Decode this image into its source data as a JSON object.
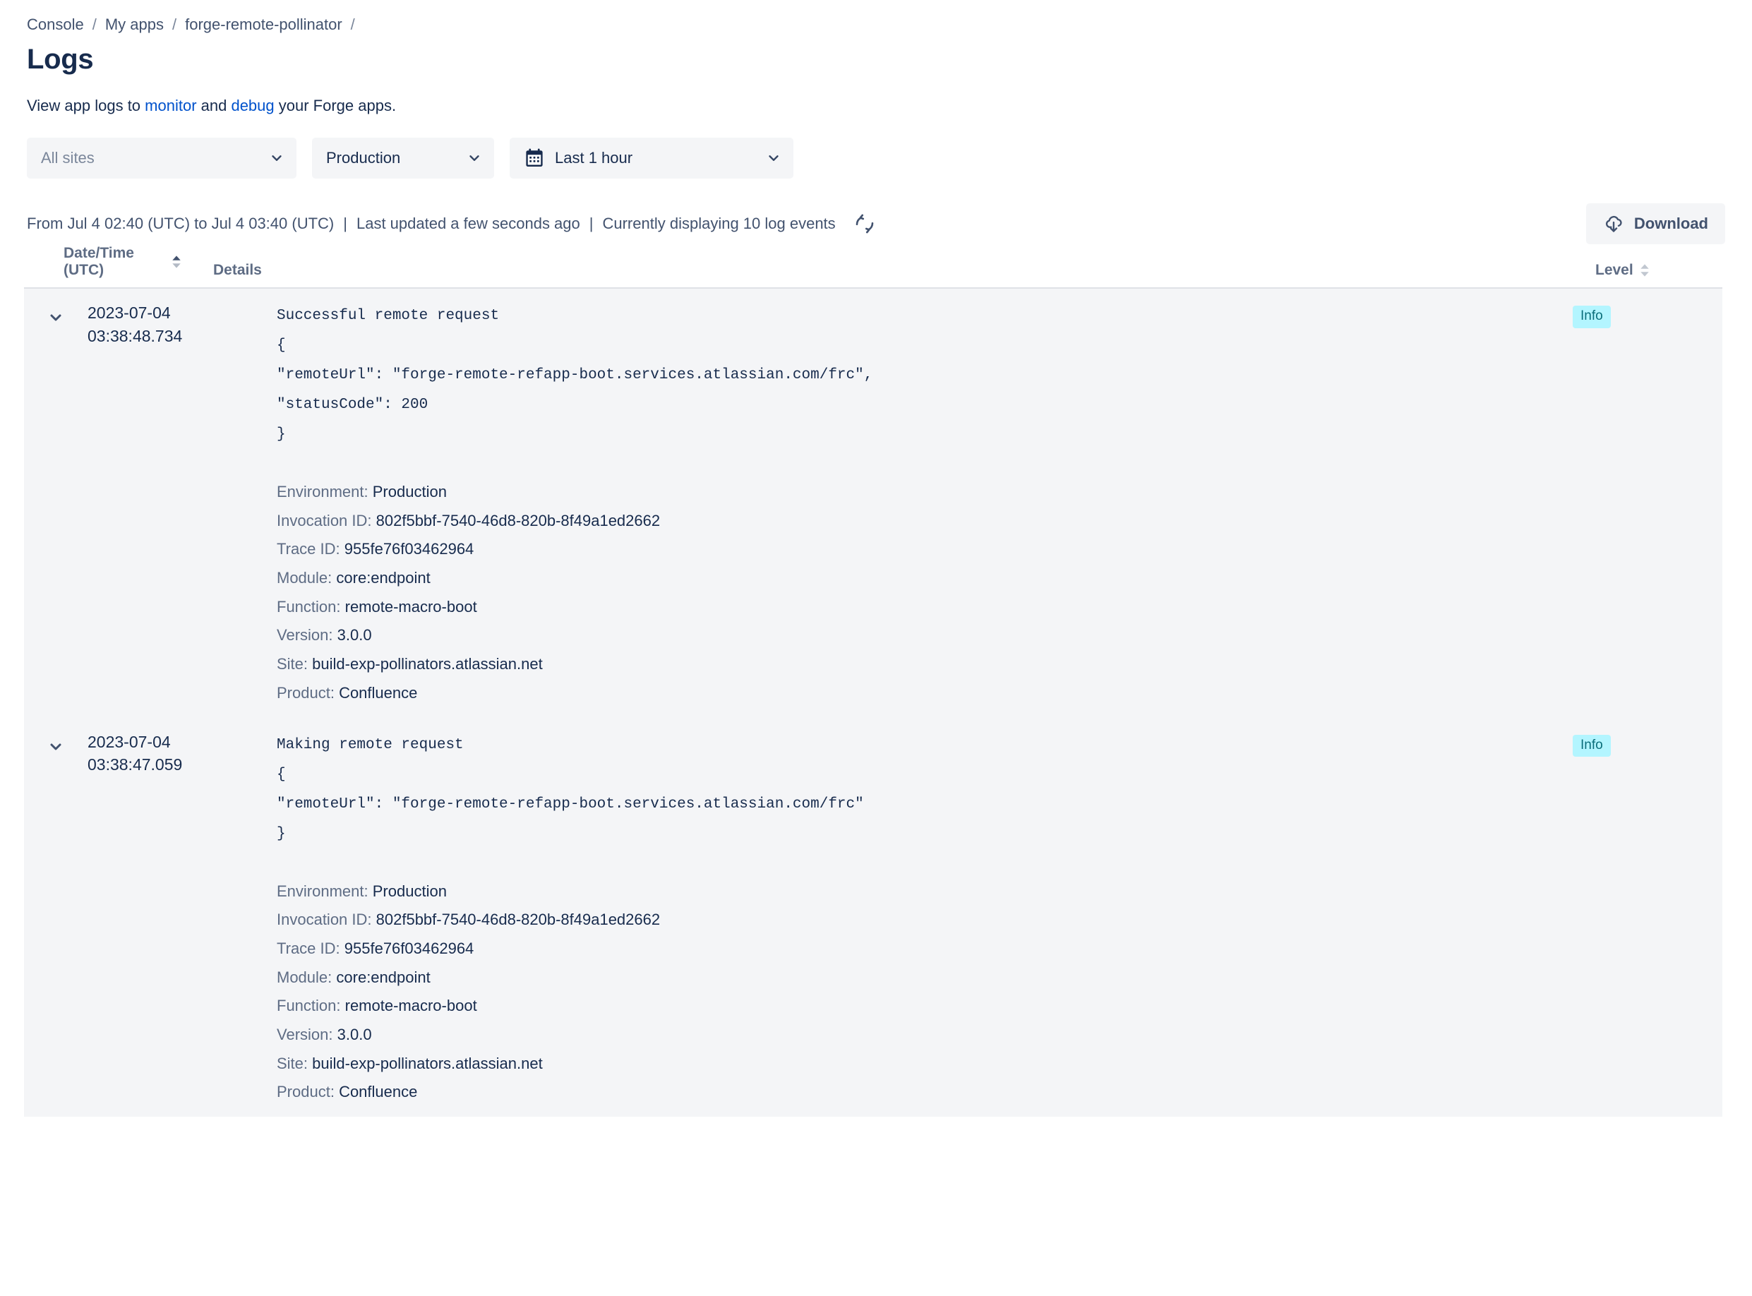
{
  "breadcrumb": {
    "items": [
      "Console",
      "My apps",
      "forge-remote-pollinator"
    ],
    "separator": "/",
    "trailing_separator": "/"
  },
  "header": {
    "title": "Logs",
    "description_prefix": "View app logs to ",
    "link_monitor": "monitor",
    "description_mid": " and ",
    "link_debug": "debug",
    "description_suffix": " your Forge apps."
  },
  "filters": {
    "site": {
      "value": "All sites",
      "icon": "chevron-down-icon"
    },
    "environment": {
      "value": "Production",
      "icon": "chevron-down-icon"
    },
    "timerange": {
      "value": "Last 1 hour",
      "icon": "calendar-icon",
      "chevron": "chevron-down-icon"
    }
  },
  "statusbar": {
    "range": "From Jul 4 02:40 (UTC) to Jul 4 03:40 (UTC)",
    "separator": "|",
    "last_updated": "Last updated a few seconds ago",
    "count": "Currently displaying 10 log events",
    "refresh_icon": "refresh-icon",
    "download_label": "Download",
    "download_icon": "cloud-download-icon"
  },
  "table": {
    "columns": {
      "datetime": "Date/Time (UTC)",
      "details": "Details",
      "level": "Level"
    },
    "sort": {
      "datetime": "asc",
      "level": "none"
    },
    "rows": [
      {
        "expanded": true,
        "date": "2023-07-04",
        "time": "03:38:48.734",
        "message": "Successful remote request\n{\n\"remoteUrl\": \"forge-remote-refapp-boot.services.atlassian.com/frc\",\n\"statusCode\": 200\n}",
        "level": "Info",
        "meta": [
          {
            "label": "Environment",
            "value": "Production"
          },
          {
            "label": "Invocation ID",
            "value": "802f5bbf-7540-46d8-820b-8f49a1ed2662"
          },
          {
            "label": "Trace ID",
            "value": "955fe76f03462964"
          },
          {
            "label": "Module",
            "value": "core:endpoint"
          },
          {
            "label": "Function",
            "value": "remote-macro-boot"
          },
          {
            "label": "Version",
            "value": "3.0.0"
          },
          {
            "label": "Site",
            "value": "build-exp-pollinators.atlassian.net"
          },
          {
            "label": "Product",
            "value": "Confluence"
          }
        ]
      },
      {
        "expanded": true,
        "date": "2023-07-04",
        "time": "03:38:47.059",
        "message": "Making remote request\n{\n\"remoteUrl\": \"forge-remote-refapp-boot.services.atlassian.com/frc\"\n}",
        "level": "Info",
        "meta": [
          {
            "label": "Environment",
            "value": "Production"
          },
          {
            "label": "Invocation ID",
            "value": "802f5bbf-7540-46d8-820b-8f49a1ed2662"
          },
          {
            "label": "Trace ID",
            "value": "955fe76f03462964"
          },
          {
            "label": "Module",
            "value": "core:endpoint"
          },
          {
            "label": "Function",
            "value": "remote-macro-boot"
          },
          {
            "label": "Version",
            "value": "3.0.0"
          },
          {
            "label": "Site",
            "value": "build-exp-pollinators.atlassian.net"
          },
          {
            "label": "Product",
            "value": "Confluence"
          }
        ]
      }
    ]
  },
  "colors": {
    "link": "#0052CC",
    "text_primary": "#172B4D",
    "text_subtle": "#5E6C84",
    "row_bg": "#F4F5F7",
    "badge_bg": "#B3F5FF",
    "badge_text": "#0B6E7A",
    "border": "#DFE1E6"
  }
}
